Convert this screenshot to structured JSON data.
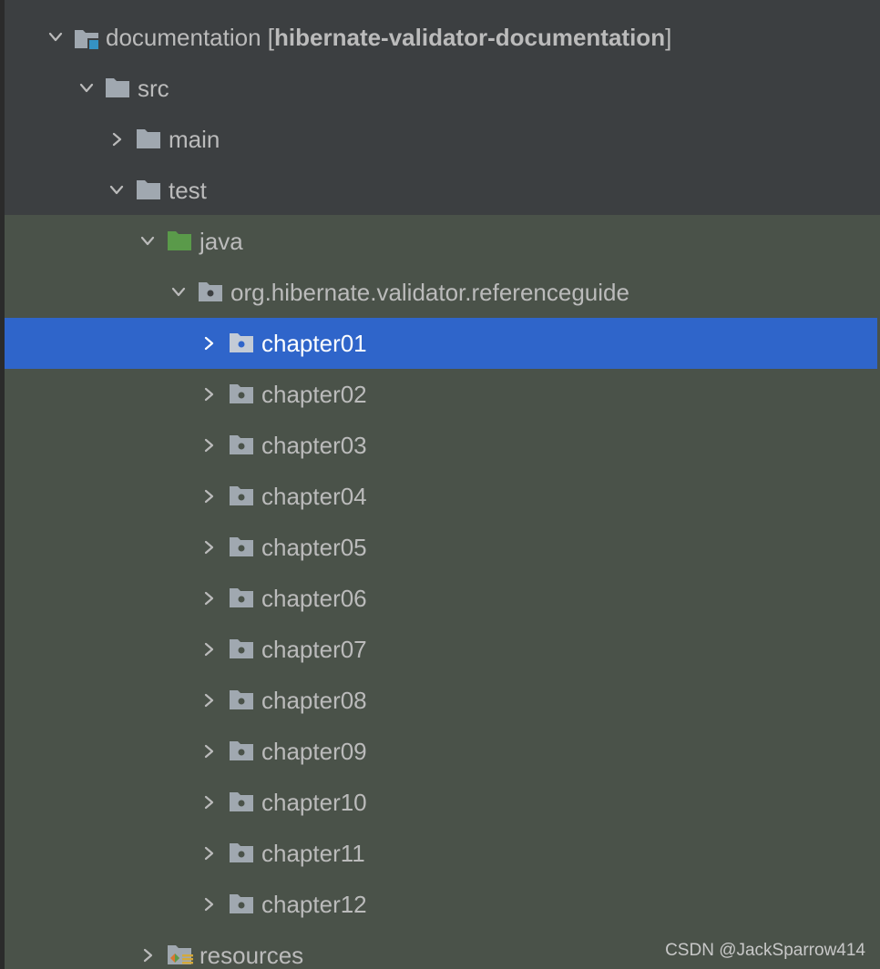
{
  "tree": {
    "module": {
      "name": "documentation",
      "bracket_open": "[",
      "bold_name": "hibernate-validator-documentation",
      "bracket_close": "]"
    },
    "src": "src",
    "main": "main",
    "test": "test",
    "java": "java",
    "package": "org.hibernate.validator.referenceguide",
    "chapters": [
      "chapter01",
      "chapter02",
      "chapter03",
      "chapter04",
      "chapter05",
      "chapter06",
      "chapter07",
      "chapter08",
      "chapter09",
      "chapter10",
      "chapter11",
      "chapter12"
    ],
    "resources": "resources",
    "selected": "chapter01"
  },
  "colors": {
    "background": "#3c3f41",
    "test_scope_background": "#4a5249",
    "selection": "#2f65ca",
    "text": "#bbbbbb",
    "folder": "#a0a8b0",
    "source_root_folder": "#5a9a4a",
    "module_badge": "#3592c4"
  },
  "watermark": "CSDN @JackSparrow414"
}
